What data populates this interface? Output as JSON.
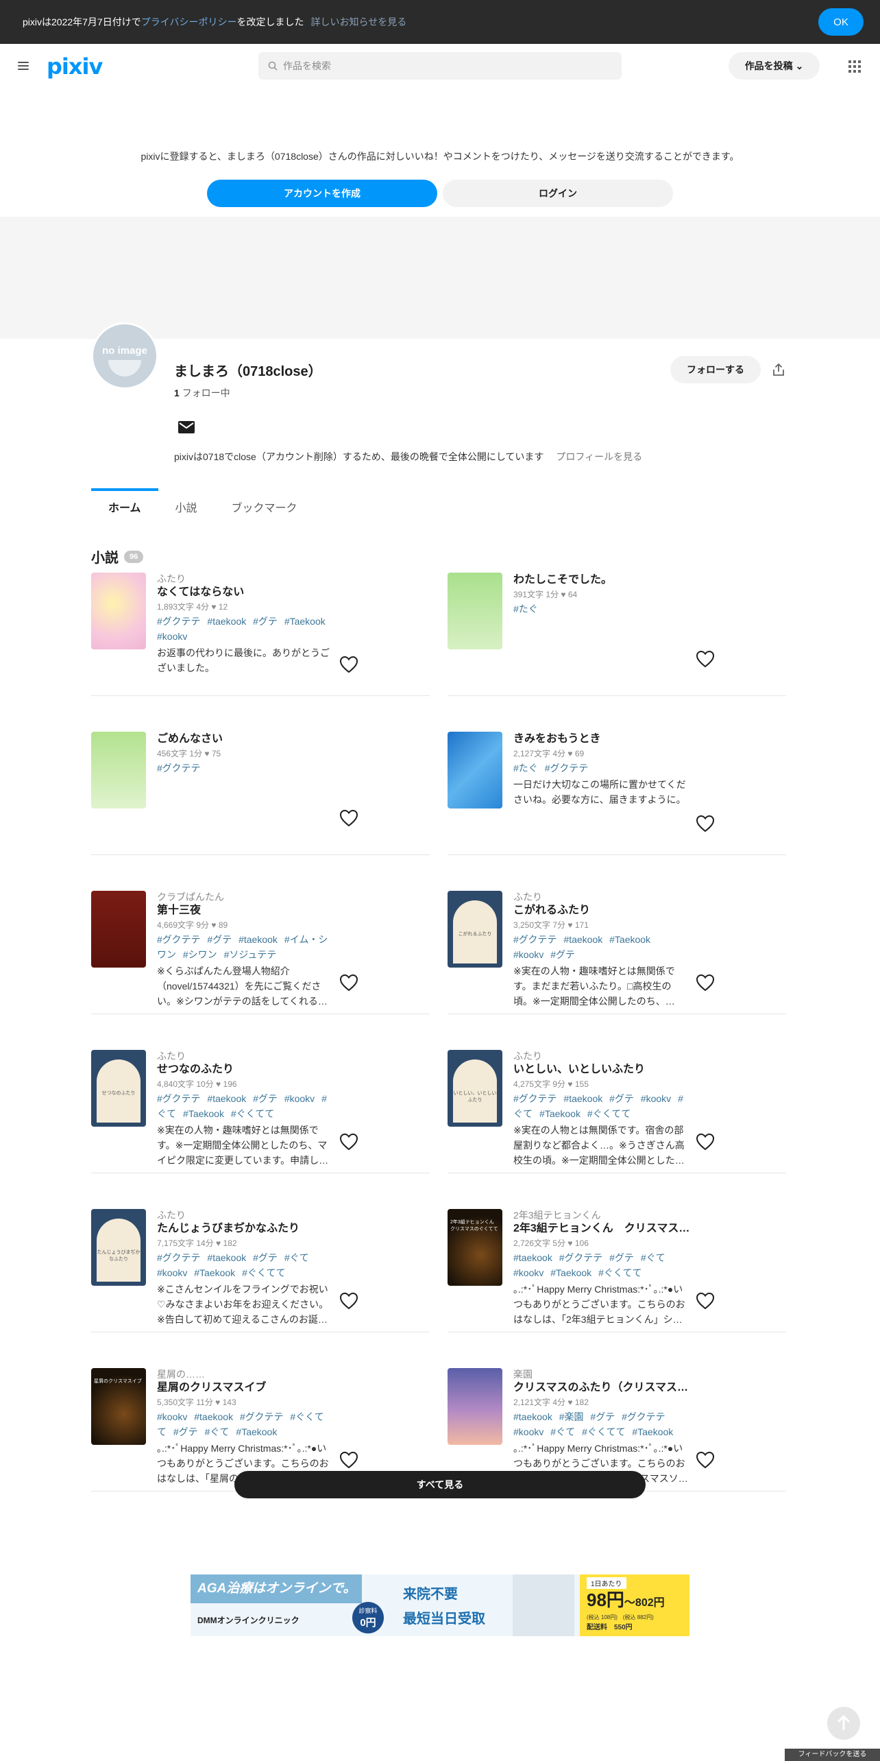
{
  "notice": {
    "pre": "pixivは2022年7月7日付けで",
    "link": "プライバシーポリシー",
    "post": "を改定しました",
    "more": "詳しいお知らせを見る",
    "ok": "OK"
  },
  "header": {
    "logo": "pixiv",
    "search_placeholder": "作品を検索",
    "post_button": "作品を投稿"
  },
  "signup": {
    "message": "pixivに登録すると、ましまろ（0718close）さんの作品に対しいいね！やコメントをつけたり、メッセージを送り交流することができます。",
    "create": "アカウントを作成",
    "login": "ログイン"
  },
  "profile": {
    "avatar_text": "no image",
    "name": "ましまろ（0718close）",
    "follow_count": "1",
    "follow_label": "フォロー中",
    "follow_button": "フォローする",
    "bio": "pixivは0718でclose（アカウント削除）するため、最後の晩餐で全体公開にしています",
    "profile_link": "プロフィールを見る"
  },
  "tabs": [
    "ホーム",
    "小説",
    "ブックマーク"
  ],
  "section": {
    "title": "小説",
    "count": "96"
  },
  "novels": [
    {
      "series": "ふたり",
      "title": "なくてはならない",
      "meta": "1,893文字 4分",
      "likes": "12",
      "tags": [
        "#グクテテ",
        "#taekook",
        "#グテ",
        "#Taekook",
        "#kookv"
      ],
      "desc": "お返事の代わりに最後に。ありがとうございました。",
      "thumb": "pastel"
    },
    {
      "series": "",
      "title": "わたしこそでした。",
      "meta": "391文字 1分",
      "likes": "64",
      "tags": [
        "#たぐ"
      ],
      "desc": "",
      "thumb": "green"
    },
    {
      "series": "",
      "title": "ごめんなさい",
      "meta": "456文字 1分",
      "likes": "75",
      "tags": [
        "#グクテテ"
      ],
      "desc": "",
      "thumb": "green2"
    },
    {
      "series": "",
      "title": "きみをおもうとき",
      "meta": "2,127文字 4分",
      "likes": "69",
      "tags": [
        "#たぐ",
        "#グクテテ"
      ],
      "desc": "一日だけ大切なこの場所に置かせてくださいね。必要な方に、届きますように。",
      "thumb": "water"
    },
    {
      "series": "クラブぱんたん",
      "title": "第十三夜",
      "meta": "4,669文字 9分",
      "likes": "89",
      "tags": [
        "#グクテテ",
        "#グテ",
        "#taekook",
        "#イム・シワン",
        "#シワン",
        "#ソジュテテ"
      ],
      "desc": "※くらぶぱんたん登場人物紹介（novel/15744321）を先にご覧ください。※シワンがテテの話をしてくれる…",
      "thumb": "red"
    },
    {
      "series": "ふたり",
      "title": "こがれるふたり",
      "meta": "3,250文字 7分",
      "likes": "171",
      "tags": [
        "#グクテテ",
        "#taekook",
        "#Taekook",
        "#kookv",
        "#グテ"
      ],
      "desc": "※実在の人物・趣味嗜好とは無関係です。まだまだ若いふたり。□高校生の頃。※一定期間全体公開したのち、…",
      "thumb": "arch",
      "thumb_text": "こがれるふたり"
    },
    {
      "series": "ふたり",
      "title": "せつなのふたり",
      "meta": "4,840文字 10分",
      "likes": "196",
      "tags": [
        "#グクテテ",
        "#taekook",
        "#グテ",
        "#kookv",
        "#ぐて",
        "#Taekook",
        "#ぐくてて"
      ],
      "desc": "※実在の人物・趣味嗜好とは無関係です。※一定期間全体公開としたのち、マイピク限定に変更しています。申請し…",
      "thumb": "arch",
      "thumb_text": "せつなのふたり"
    },
    {
      "series": "ふたり",
      "title": "いとしい、いとしいふたり",
      "meta": "4,275文字 9分",
      "likes": "155",
      "tags": [
        "#グクテテ",
        "#taekook",
        "#グテ",
        "#kookv",
        "#ぐて",
        "#Taekook",
        "#ぐくてて"
      ],
      "desc": "※実在の人物とは無関係です。宿舎の部屋割りなど都合よく…。※うさぎさん高校生の頃。※一定期間全体公開とした…",
      "thumb": "arch",
      "thumb_text": "いとしい、いとしいふたり"
    },
    {
      "series": "ふたり",
      "title": "たんじょうびまぢかなふたり",
      "meta": "7,175文字 14分",
      "likes": "182",
      "tags": [
        "#グクテテ",
        "#taekook",
        "#グテ",
        "#ぐて",
        "#kookv",
        "#Taekook",
        "#ぐくてて"
      ],
      "desc": "※こさんセンイルをフライングでお祝い♡みなさまよいお年をお迎えください。※告白して初めて迎えるこさんのお誕…",
      "thumb": "arch",
      "thumb_text": "たんじょうびまぢかなふたり"
    },
    {
      "series": "2年3組テヒョンくん",
      "title": "2年3組テヒョンくん　クリスマス…",
      "meta": "2,726文字 5分",
      "likes": "106",
      "tags": [
        "#taekook",
        "#グクテテ",
        "#グテ",
        "#ぐて",
        "#kookv",
        "#Taekook",
        "#ぐくてて"
      ],
      "desc": "｡.:*･ﾟHappy Merry Christmas:*･ﾟ｡.:*●いつもありがとうございます。こちらのおはなしは、「2年3組テヒョンくん」シ…",
      "thumb": "xmas",
      "thumb_text": "2年3組テヒョンくん　クリスマスのぐくてて"
    },
    {
      "series": "星屑の……",
      "title": "星屑のクリスマスイブ",
      "meta": "5,350文字 11分",
      "likes": "143",
      "tags": [
        "#kookv",
        "#taekook",
        "#グクテテ",
        "#ぐくてて",
        "#グテ",
        "#ぐて",
        "#Taekook"
      ],
      "desc": "｡.:*･ﾟHappy Merry Christmas:*･ﾟ｡.:*●いつもありがとうございます。こちらのおはなしは、「星屑の……」シリーズの…",
      "thumb": "xmas",
      "thumb_text": "星屑のクリスマスイブ"
    },
    {
      "series": "楽園",
      "title": "クリスマスのふたり（クリスマス…",
      "meta": "2,121文字 4分",
      "likes": "182",
      "tags": [
        "#taekook",
        "#楽園",
        "#グテ",
        "#グクテテ",
        "#kookv",
        "#ぐて",
        "#ぐくてて",
        "#Taekook"
      ],
      "desc": "｡.:*･ﾟHappy Merry Christmas:*･ﾟ｡.:*●いつもありがとうございます。こちらのおはなしは、2021「楽園」クリスマスソ…",
      "thumb": "sky"
    }
  ],
  "see_all": "すべて見る",
  "ad": {
    "headline": "AGA治療はオンラインで。",
    "brand": "DMMオンラインクリニック",
    "fee_label": "診察料",
    "fee": "0円",
    "point1": "来院不要",
    "point2": "最短当日受取",
    "per_day": "1日あたり",
    "price": "98円",
    "price_max": "～802円",
    "price_note": "(税込 108円)　(税込 882円)",
    "shipping": "配送料　550円"
  },
  "feedback": "フィードバックを送る"
}
